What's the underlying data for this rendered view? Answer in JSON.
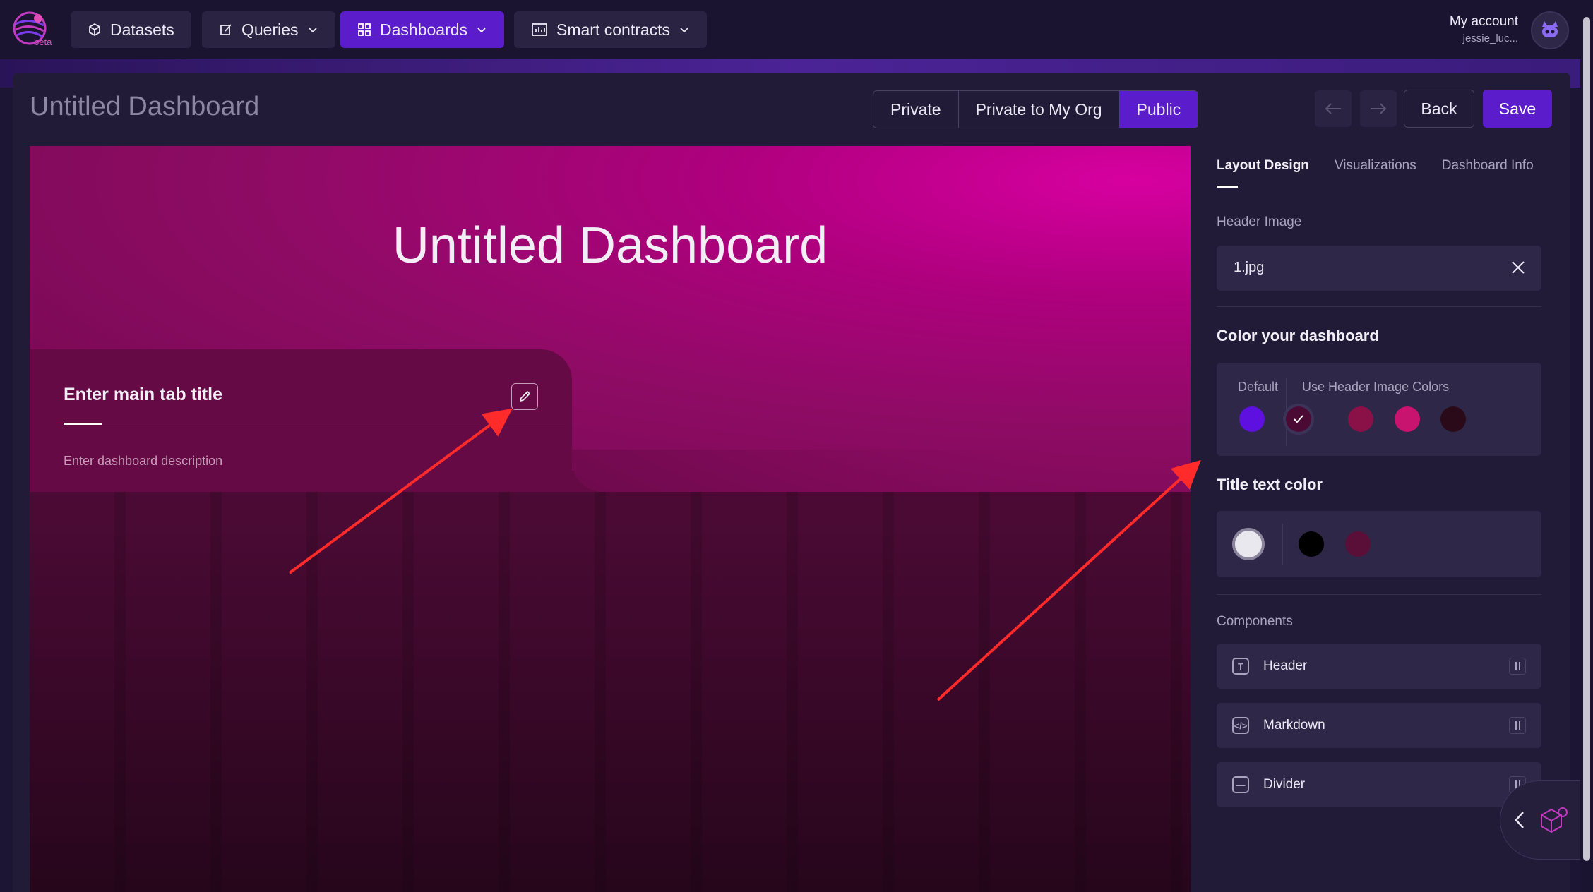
{
  "nav": {
    "logo_badge": "beta",
    "items": [
      {
        "label": "Datasets",
        "icon": "cube-icon"
      },
      {
        "label": "Queries",
        "icon": "edit-icon"
      },
      {
        "label": "Dashboards",
        "icon": "grid-icon"
      },
      {
        "label": "Smart contracts",
        "icon": "chart-icon"
      }
    ],
    "active": "Dashboards",
    "account_label": "My account",
    "account_user": "jessie_luc..."
  },
  "toolbar": {
    "page_title": "Untitled Dashboard",
    "privacy_options": [
      "Private",
      "Private to My Org",
      "Public"
    ],
    "privacy_selected": "Public",
    "back_label": "Back",
    "save_label": "Save"
  },
  "canvas": {
    "header_title": "Untitled Dashboard",
    "tab_title": "Enter main tab title",
    "tab_description": "Enter dashboard description"
  },
  "sidebar": {
    "tabs": [
      "Layout Design",
      "Visualizations",
      "Dashboard Info"
    ],
    "active_tab": "Layout Design",
    "header_image_label": "Header Image",
    "header_image_file": "1.jpg",
    "color_section_title": "Color your dashboard",
    "default_label": "Default",
    "header_colors_label": "Use Header Image Colors",
    "dashboard_colors": {
      "default": "#5e10e0",
      "header_image": [
        "#4a0a34",
        "#8a1048",
        "#c8136f",
        "#2a0a18"
      ],
      "selected_index": 0
    },
    "title_text_color_title": "Title text color",
    "title_text_colors": [
      "#e8e8ee",
      "#000000",
      "#5a0f38"
    ],
    "components_label": "Components",
    "components": [
      {
        "label": "Header",
        "icon": "text-t-icon"
      },
      {
        "label": "Markdown",
        "icon": "code-icon"
      },
      {
        "label": "Divider",
        "icon": "divider-icon"
      }
    ]
  },
  "colors": {
    "accent": "#5b1ccc",
    "annotation_arrow": "#ff2a2a"
  }
}
